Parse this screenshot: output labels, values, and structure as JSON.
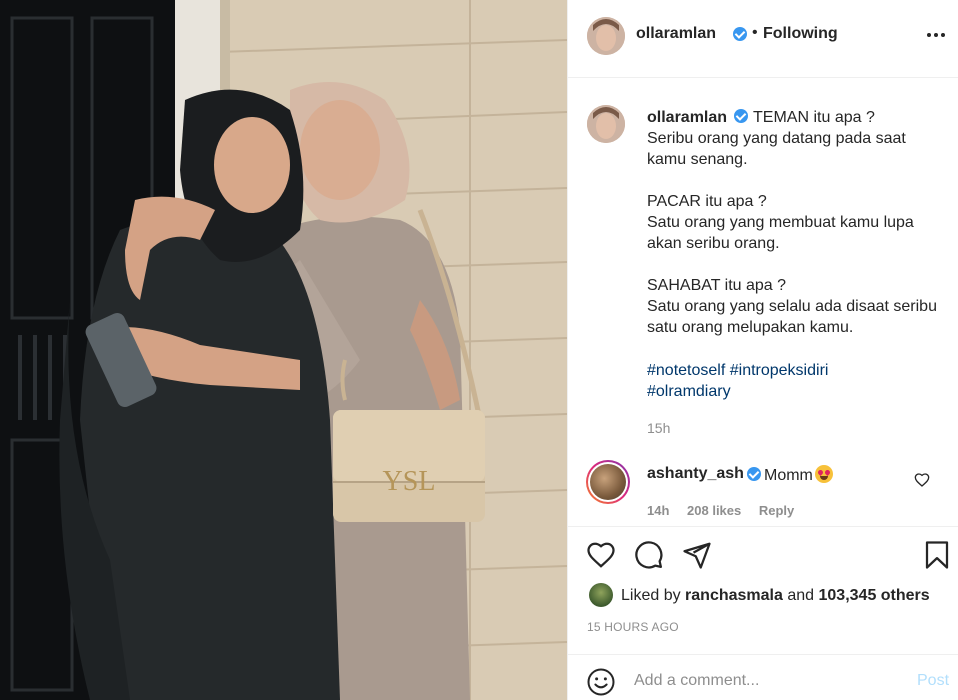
{
  "post": {
    "photo_alt": "",
    "author": {
      "username": "ollaramlan",
      "verified": true,
      "follow_status": "Following",
      "separator": "•"
    },
    "caption": {
      "username": "ollaramlan",
      "text": "TEMAN itu apa ?\nSeribu orang yang datang pada saat kamu senang.\n\nPACAR itu apa ?\nSatu orang yang membuat kamu lupa akan seribu orang.\n\nSAHABAT itu apa ?\nSatu orang yang selalu ada disaat seribu satu orang melupakan kamu.",
      "hashtags": [
        "#notetoself",
        "#intropeksidiri",
        "#olramdiary"
      ],
      "time": "15h"
    },
    "comments": [
      {
        "username": "ashanty_ash",
        "verified": true,
        "text": "Momm",
        "emoji": "heart-eyes-emoji",
        "time": "14h",
        "likes": "208 likes",
        "reply_label": "Reply"
      }
    ],
    "likes": {
      "prefix": "Liked by",
      "liker": "ranchasmala",
      "conjunction": "and",
      "others": "103,345 others"
    },
    "timestamp": "15 HOURS AGO",
    "add_comment": {
      "placeholder": "Add a comment...",
      "post_label": "Post"
    }
  },
  "icons": {
    "more": "more-options-icon",
    "like": "heart-icon",
    "comment": "comment-icon",
    "share": "share-icon",
    "save": "bookmark-icon",
    "emoji": "smiley-icon"
  },
  "colors": {
    "link": "#00376b",
    "verified": "#3897f0",
    "muted": "#8e8e8e",
    "post_disabled": "#b2dffc"
  }
}
